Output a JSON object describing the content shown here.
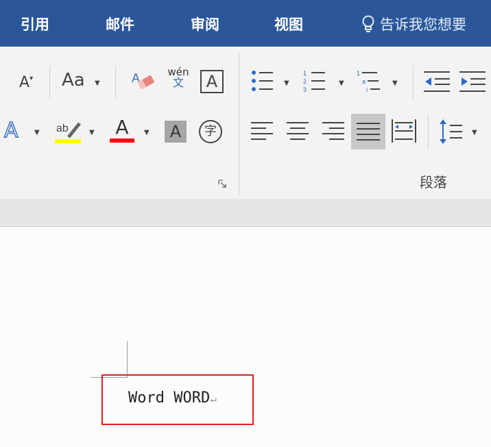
{
  "tabs": [
    {
      "label": "引用"
    },
    {
      "label": "邮件"
    },
    {
      "label": "审阅"
    },
    {
      "label": "视图"
    }
  ],
  "tellme": {
    "label": "告诉我您想要"
  },
  "ribbon": {
    "font_group": {
      "change_case_label": "Aa",
      "pinyin_top": "wén",
      "pinyin_bottom": "文",
      "char_border_label": "A",
      "text_effect_label": "A",
      "highlight_label": "ab",
      "font_color_label": "A",
      "shading_label": "A",
      "enclose_label": "字",
      "grow_font_label": "A",
      "highlight_color": "#ffff00",
      "font_color": "#ff0000"
    },
    "paragraph_group": {
      "label": "段落"
    }
  },
  "document": {
    "text": "Word WORD",
    "paragraph_mark": "↵"
  }
}
